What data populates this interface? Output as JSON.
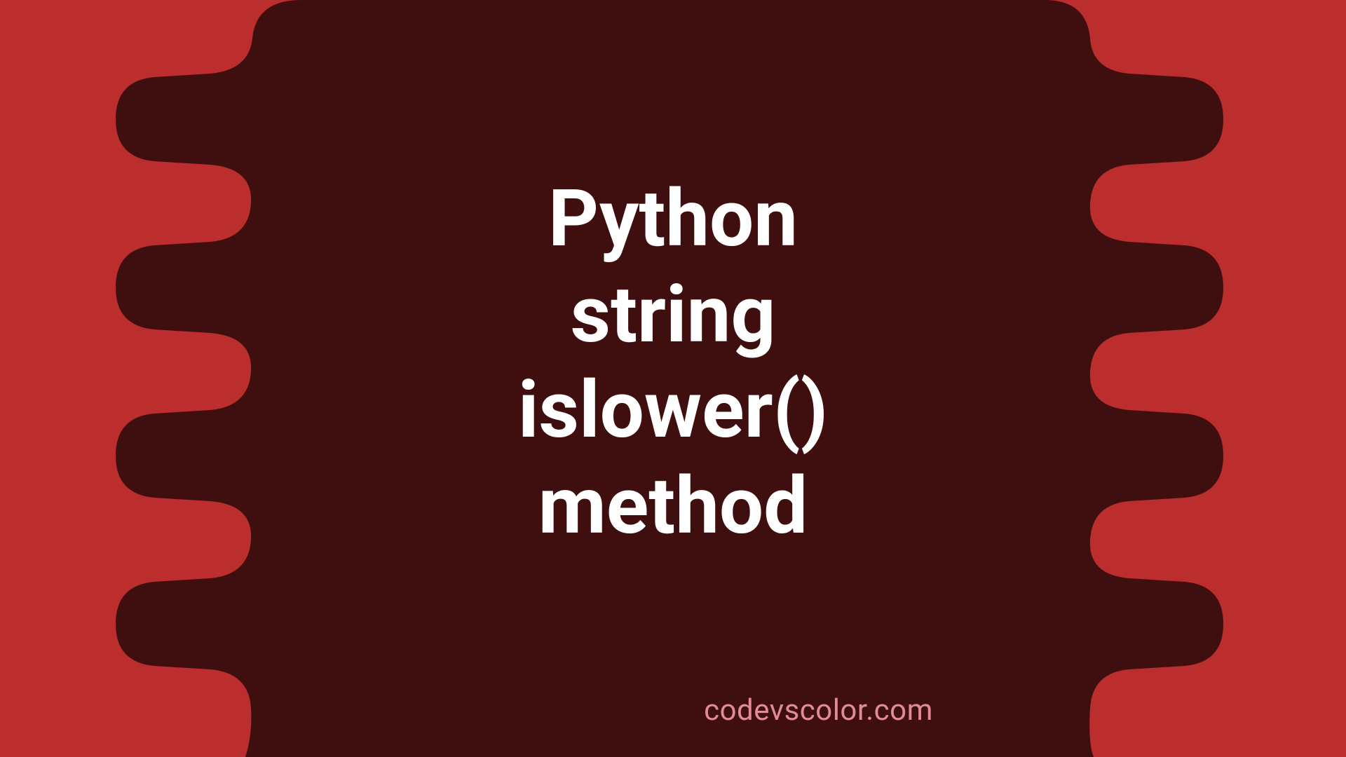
{
  "colors": {
    "bg_outer": "#bc2d2d",
    "bg_inner": "#3f0f10",
    "text_main": "#ffffff",
    "text_watermark": "#e18b96"
  },
  "title_lines": "Python\nstring\nislower()\nmethod",
  "watermark": "codevscolor.com"
}
